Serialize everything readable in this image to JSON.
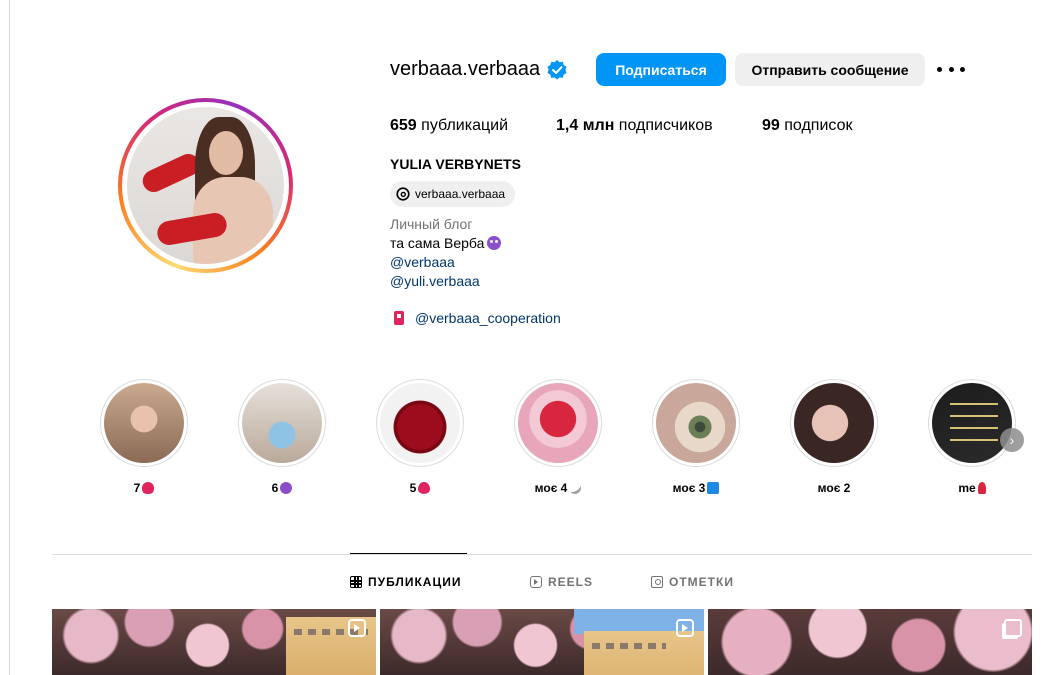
{
  "profile": {
    "username": "verbaaa.verbaaa",
    "verified_icon": "verified-badge-icon",
    "follow_label": "Подписаться",
    "message_label": "Отправить сообщение",
    "more_icon": "more-options-icon",
    "stats": {
      "posts_count": "659",
      "posts_label": " публикаций",
      "followers_count": "1,4 млн",
      "followers_label": " подписчиков",
      "following_count": "99",
      "following_label": " подписок"
    },
    "full_name": "YULIA VERBYNETS",
    "threads_handle": "verbaaa.verbaaa",
    "bio": {
      "category": "Личный блог",
      "line1": "та сама Верба",
      "mention1": "@verbaaa",
      "mention2": "@yuli.verbaaa",
      "cooperation": "@verbaaa_cooperation"
    }
  },
  "highlights": [
    {
      "label": "7",
      "emoji": "lips"
    },
    {
      "label": "6",
      "emoji": "devil"
    },
    {
      "label": "5",
      "emoji": "heart"
    },
    {
      "label": "моє 4",
      "emoji": "plane"
    },
    {
      "label": "моє 3",
      "emoji": "cube"
    },
    {
      "label": "моє 2",
      "emoji": ""
    },
    {
      "label": "me",
      "emoji": "rose"
    }
  ],
  "tabs": {
    "posts": "ПУБЛИКАЦИИ",
    "reels": "REELS",
    "tagged": "ОТМЕТКИ"
  },
  "colors": {
    "primary_button": "#0095f6",
    "secondary_button": "#efefef",
    "link": "#00376b"
  }
}
